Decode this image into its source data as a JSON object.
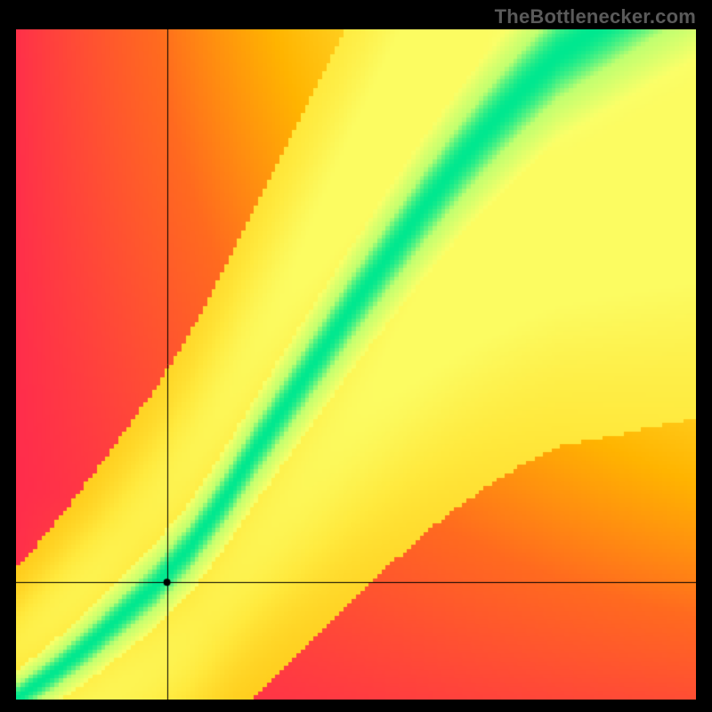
{
  "watermark": "TheBottlenecker.com",
  "colors": {
    "background": "#000000",
    "watermark": "#5a5a5a",
    "crosshair": "#000000",
    "marker": "#000000"
  },
  "chart_data": {
    "type": "heatmap",
    "title": "",
    "xlabel": "",
    "ylabel": "",
    "xlim": [
      0,
      1
    ],
    "ylim": [
      0,
      1
    ],
    "grid": false,
    "legend": false,
    "color_scale": {
      "stops": [
        {
          "t": 0.0,
          "color": "#ff2b4d"
        },
        {
          "t": 0.35,
          "color": "#ff6a1f"
        },
        {
          "t": 0.55,
          "color": "#ffb400"
        },
        {
          "t": 0.75,
          "color": "#ffe93d"
        },
        {
          "t": 0.88,
          "color": "#fbff68"
        },
        {
          "t": 0.96,
          "color": "#c0ff70"
        },
        {
          "t": 1.0,
          "color": "#00e88f"
        }
      ]
    },
    "ridge_curve": [
      {
        "x": 0.0,
        "y": 0.0
      },
      {
        "x": 0.05,
        "y": 0.035
      },
      {
        "x": 0.1,
        "y": 0.075
      },
      {
        "x": 0.15,
        "y": 0.12
      },
      {
        "x": 0.2,
        "y": 0.165
      },
      {
        "x": 0.25,
        "y": 0.22
      },
      {
        "x": 0.3,
        "y": 0.29
      },
      {
        "x": 0.35,
        "y": 0.37
      },
      {
        "x": 0.4,
        "y": 0.445
      },
      {
        "x": 0.45,
        "y": 0.52
      },
      {
        "x": 0.5,
        "y": 0.595
      },
      {
        "x": 0.55,
        "y": 0.665
      },
      {
        "x": 0.6,
        "y": 0.735
      },
      {
        "x": 0.65,
        "y": 0.8
      },
      {
        "x": 0.7,
        "y": 0.86
      },
      {
        "x": 0.75,
        "y": 0.915
      },
      {
        "x": 0.8,
        "y": 0.965
      },
      {
        "x": 0.85,
        "y": 1.0
      }
    ],
    "ridge_width": {
      "base": 0.022,
      "growth": 0.055
    },
    "crosshair": {
      "x": 0.222,
      "y": 0.175
    },
    "marker": {
      "x": 0.222,
      "y": 0.175,
      "radius_px": 4
    },
    "corner_intensity": {
      "top_left": 0.0,
      "top_right": 0.78,
      "bottom_left": 0.72,
      "bottom_right": 0.0
    }
  }
}
